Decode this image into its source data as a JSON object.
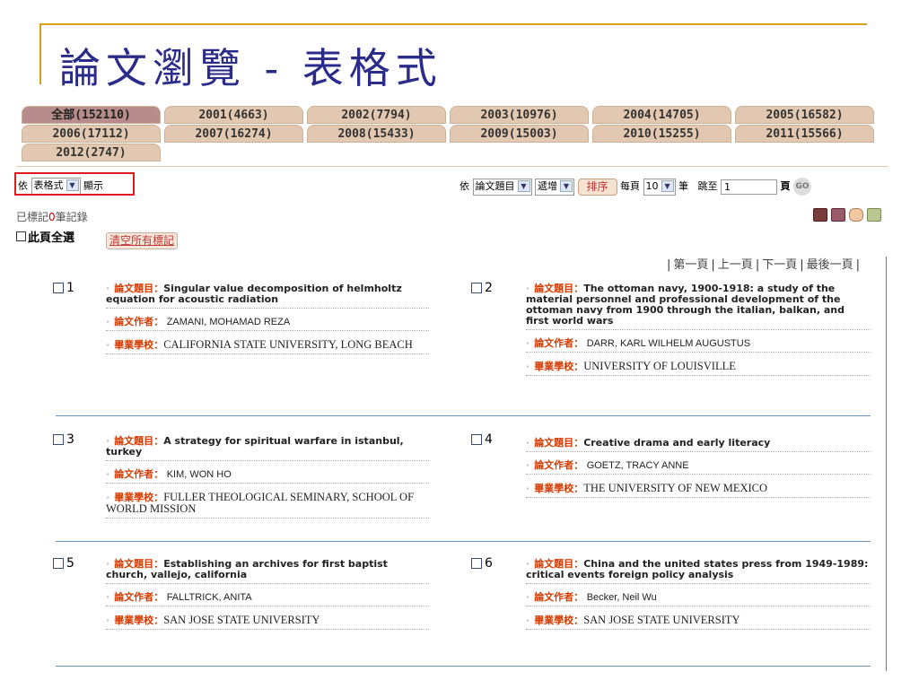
{
  "slide_title": "論文瀏覽 - 表格式",
  "tabs": [
    [
      "全部(152110)",
      "2001(4663)",
      "2002(7794)",
      "2003(10976)",
      "2004(14705)",
      "2005(16582)"
    ],
    [
      "2006(17112)",
      "2007(16274)",
      "2008(15433)",
      "2009(15003)",
      "2010(15255)",
      "2011(15566)"
    ],
    [
      "2012(2747)"
    ]
  ],
  "controls": {
    "by_label": "依",
    "format_value": "表格式",
    "display_label": "顯示",
    "sort_by_label": "依",
    "sort_field_value": "論文題目",
    "sort_order_value": "遞增",
    "sort_button": "排序",
    "per_page_label": "每頁",
    "per_page_value": "10",
    "per_page_unit": "筆",
    "jump_label": "跳至",
    "jump_value": "1",
    "jump_unit": "頁",
    "go_button": "GO"
  },
  "marked": {
    "prefix": "已標記",
    "count": "0",
    "suffix": "筆記錄"
  },
  "select_all_label": "此頁全選",
  "clear_button": "清空所有標記",
  "pager": {
    "first": "第一頁",
    "prev": "上一頁",
    "next": "下一頁",
    "last": "最後一頁"
  },
  "labels": {
    "title": "論文題目：",
    "author": "論文作者：",
    "school": "畢業學校："
  },
  "records": [
    {
      "num": "1",
      "title": "Singular value decomposition of helmholtz equation for acoustic radiation",
      "author": "ZAMANI, MOHAMAD REZA",
      "school": "CALIFORNIA STATE UNIVERSITY, LONG BEACH"
    },
    {
      "num": "2",
      "title": "The ottoman navy, 1900-1918: a study of the material personnel and professional development of the ottoman navy from 1900 through the italian, balkan, and first world wars",
      "author": "DARR, KARL WILHELM AUGUSTUS",
      "school": "UNIVERSITY OF LOUISVILLE"
    },
    {
      "num": "3",
      "title": "A strategy for spiritual warfare in istanbul, turkey",
      "author": "KIM, WON HO",
      "school": "FULLER THEOLOGICAL SEMINARY, SCHOOL OF WORLD MISSION"
    },
    {
      "num": "4",
      "title": "Creative drama and early literacy",
      "author": "GOETZ, TRACY ANNE",
      "school": "THE UNIVERSITY OF NEW MEXICO"
    },
    {
      "num": "5",
      "title": "Establishing an archives for first baptist church, vallejo, california",
      "author": "FALLTRICK, ANITA",
      "school": "SAN JOSE STATE UNIVERSITY"
    },
    {
      "num": "6",
      "title": "China and the united states press from 1949-1989: critical events foreign policy analysis",
      "author": "Becker, Neil Wu",
      "school": "SAN JOSE STATE UNIVERSITY"
    }
  ],
  "colors": {
    "accent": "#2b2b8a",
    "frame": "#d4a017",
    "active_tab": "#b88c8c",
    "tab": "#e2c8b1",
    "label": "#d53a00",
    "highlight": "#e0191c"
  }
}
